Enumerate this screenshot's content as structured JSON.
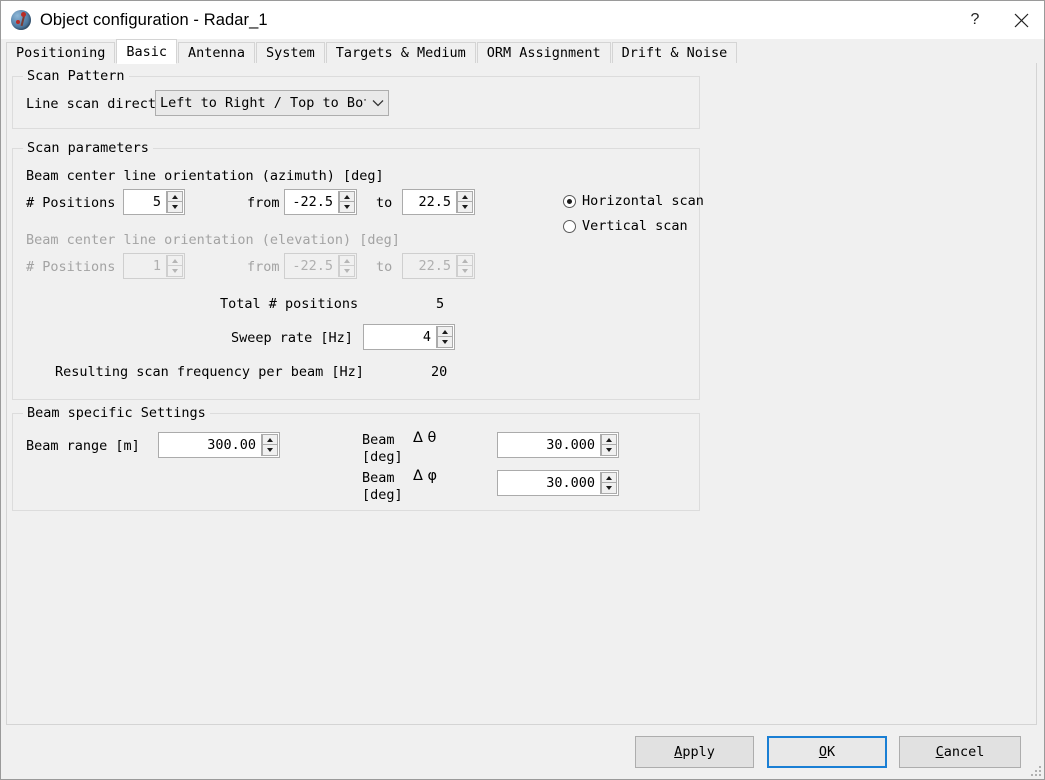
{
  "window": {
    "title": "Object configuration - Radar_1",
    "icon": "radar-globe-icon",
    "help_label": "?",
    "close_label": "✕"
  },
  "tabs": [
    {
      "label": "Positioning",
      "active": false
    },
    {
      "label": "Basic",
      "active": true
    },
    {
      "label": "Antenna",
      "active": false
    },
    {
      "label": "System",
      "active": false
    },
    {
      "label": "Targets & Medium",
      "active": false
    },
    {
      "label": "ORM Assignment",
      "active": false
    },
    {
      "label": "Drift & Noise",
      "active": false
    }
  ],
  "scan_pattern": {
    "group_label": "Scan Pattern",
    "line_scan_direction_label": "Line scan directi",
    "line_scan_direction_value": "Left to Right / Top to Botto"
  },
  "scan_parameters": {
    "group_label": "Scan parameters",
    "azimuth_header": "Beam center line orientation (azimuth) [deg]",
    "elevation_header": "Beam center line orientation (elevation) [deg]",
    "positions_label": "# Positions",
    "from_label": "from",
    "to_label": "to",
    "azimuth_positions": "5",
    "azimuth_from": "-22.5",
    "azimuth_to": "22.5",
    "elevation_positions": "1",
    "elevation_from": "-22.5",
    "elevation_to": "22.5",
    "scan_orientation": [
      {
        "label": "Horizontal scan",
        "selected": true
      },
      {
        "label": "Vertical scan",
        "selected": false
      }
    ],
    "total_positions_label": "Total # positions",
    "total_positions_value": "5",
    "sweep_rate_label": "Sweep rate [Hz]",
    "sweep_rate_value": "4",
    "resulting_frequency_label": "Resulting scan frequency per beam [Hz]",
    "resulting_frequency_value": "20"
  },
  "beam_settings": {
    "group_label": "Beam specific Settings",
    "beam_range_label": "Beam range [m]",
    "beam_range_value": "300.00",
    "delta_theta_label_line1": "Beam",
    "delta_theta_symbol": "Δ θ",
    "delta_theta_label_line2": "[deg]",
    "delta_theta_value": "30.000",
    "delta_phi_label_line1": "Beam",
    "delta_phi_symbol": "Δ φ",
    "delta_phi_label_line2": "[deg]",
    "delta_phi_value": "30.000"
  },
  "footer": {
    "apply": "Apply",
    "apply_mnemonic": "A",
    "ok": "OK",
    "ok_mnemonic": "O",
    "cancel": "Cancel",
    "cancel_mnemonic": "C"
  },
  "colors": {
    "background": "#f0f0f0",
    "focus_border": "#1a7fd4",
    "field_background": "#ffffff",
    "disabled_text": "#a3a3a3"
  }
}
